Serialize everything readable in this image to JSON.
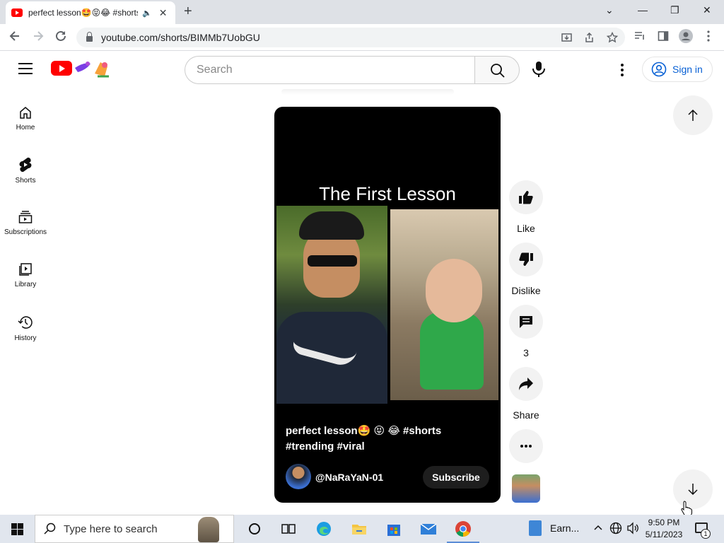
{
  "browser": {
    "tab_title": "perfect lesson🤩😝😂 #shorts",
    "tab_close": "✕",
    "new_tab": "+",
    "url": "youtube.com/shorts/BIMMb7UobGU",
    "window_controls": {
      "minimize": "—",
      "restore": "❐",
      "close": "✕",
      "tab_search": "⌄"
    }
  },
  "masthead": {
    "search_placeholder": "Search",
    "sign_in": "Sign in"
  },
  "sidebar": {
    "items": [
      {
        "label": "Home",
        "icon": "home-icon"
      },
      {
        "label": "Shorts",
        "icon": "shorts-icon"
      },
      {
        "label": "Subscriptions",
        "icon": "subscriptions-icon"
      },
      {
        "label": "Library",
        "icon": "library-icon"
      },
      {
        "label": "History",
        "icon": "history-icon"
      }
    ]
  },
  "short": {
    "video_title": "The First Lesson",
    "caption": "perfect lesson🤩 😝 😂 #shorts #trending #viral",
    "channel": "@NaRaYaN-01",
    "subscribe": "Subscribe"
  },
  "actions": {
    "like": "Like",
    "dislike": "Dislike",
    "comments": "3",
    "share": "Share"
  },
  "taskbar": {
    "search_placeholder": "Type here to search",
    "app_label": "Earn...",
    "time": "9:50 PM",
    "date": "5/11/2023",
    "notification_count": "1"
  },
  "colors": {
    "youtube_red": "#ff0000",
    "link_blue": "#065fd4",
    "taskbar": "#e1e6ee"
  }
}
